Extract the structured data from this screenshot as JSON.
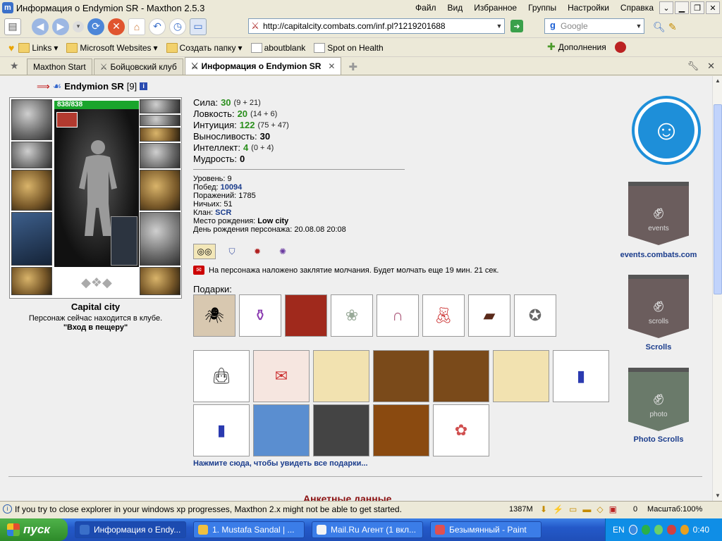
{
  "window": {
    "title": "Информация о Endymion SR - Maxthon 2.5.3",
    "menu": [
      "Файл",
      "Вид",
      "Избранное",
      "Группы",
      "Настройки",
      "Справка"
    ]
  },
  "toolbar": {
    "url": "http://capitalcity.combats.com/inf.pl?1219201688",
    "search_placeholder": "Google"
  },
  "bookmarks": {
    "items": [
      "Links",
      "Microsoft Websites",
      "Создать папку",
      "aboutblank",
      "Spot on Health"
    ],
    "addons_label": "Дополнения"
  },
  "tabs": [
    "Maxthon Start",
    "Бойцовский клуб",
    "Информация о Endymion SR"
  ],
  "character": {
    "name": "Endymion SR",
    "level": "[9]",
    "hp": "838/838",
    "city": "Capital city",
    "location_text": "Персонаж сейчас находится в клубе.",
    "room": "\"Вход в пещеру\""
  },
  "stats": [
    {
      "label": "Сила:",
      "value": "30",
      "mod": "(9 + 21)"
    },
    {
      "label": "Ловкость:",
      "value": "20",
      "mod": "(14 + 6)"
    },
    {
      "label": "Интуиция:",
      "value": "122",
      "mod": "(75 + 47)"
    },
    {
      "label": "Выносливость:",
      "value": "30",
      "mod": ""
    },
    {
      "label": "Интеллект:",
      "value": "4",
      "mod": "(0 + 4)"
    },
    {
      "label": "Мудрость:",
      "value": "0",
      "mod": ""
    }
  ],
  "info": {
    "level_label": "Уровень:",
    "level": "9",
    "wins_label": "Побед:",
    "wins": "10094",
    "losses_label": "Поражений:",
    "losses": "1785",
    "draws_label": "Ничьих:",
    "draws": "51",
    "clan_label": "Клан:",
    "clan": "SCR",
    "birthplace_label": "Место рождения:",
    "birthplace": "Low city",
    "birthday_label": "День рождения персонажа:",
    "birthday": "20.08.08 20:08"
  },
  "silence_text": "На персонажа наложено заклятие молчания. Будет молчать еще 19 мин. 21 сек.",
  "gifts": {
    "label": "Подарки:",
    "link": "Нажмите сюда, чтобы увидеть все подарки..."
  },
  "anketa_label": "Анкетные данные",
  "sidebar": {
    "events_banner_text": "events",
    "events_label": "events.combats.com",
    "scrolls_banner_text": "scrolls",
    "scrolls_label": "Scrolls",
    "photo_banner_text": "photo",
    "photo_label": "Photo Scrolls"
  },
  "statusbar": {
    "message": "If you try to close explorer in your windows xp progresses, Maxthon 2.x might not be able to get started.",
    "memory": "1387M",
    "count": "0",
    "zoom": "Масштаб:100%"
  },
  "taskbar": {
    "start": "пуск",
    "tasks": [
      "Информация о Endy...",
      "1. Mustafa Sandal | ...",
      "Mail.Ru Агент (1 вкл...",
      "Безымянный - Paint"
    ],
    "lang": "EN",
    "clock": "0:40"
  }
}
